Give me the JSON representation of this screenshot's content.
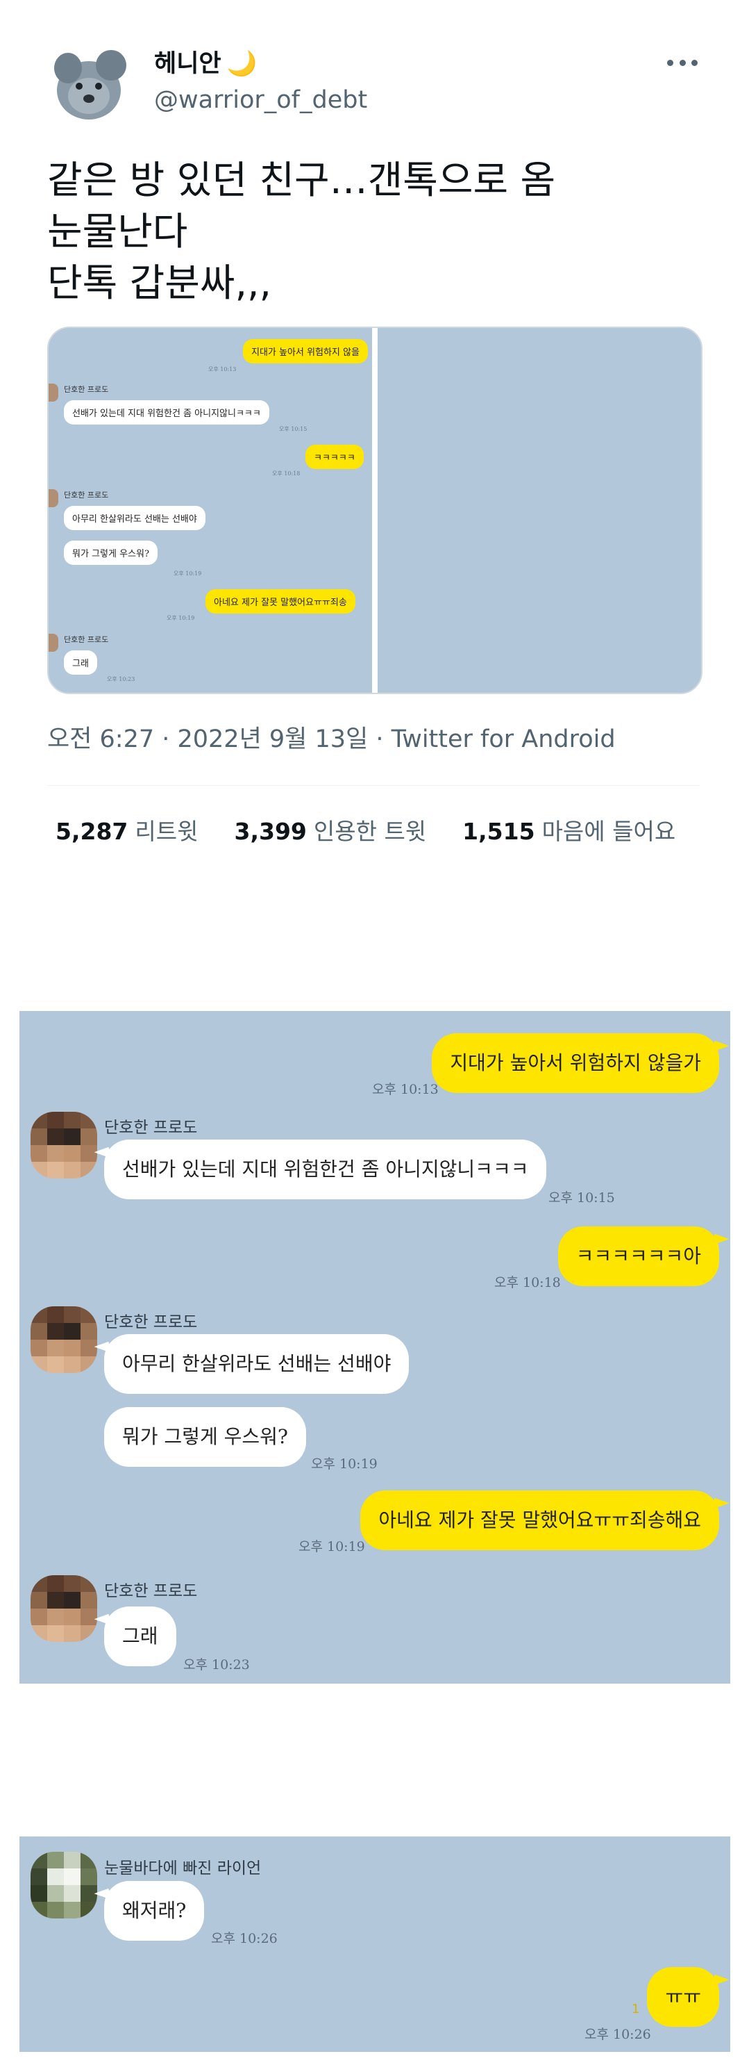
{
  "tweet": {
    "name": "헤니안",
    "moon_emoji": "🌙",
    "handle": "@warrior_of_debt",
    "text_lines": [
      "같은 방 있던 친구…갠톡으로 옴",
      "눈물난다",
      "단톡 갑분싸,,,"
    ],
    "meta": "오전 6:27 · 2022년 9월 13일 · Twitter for Android",
    "stats": [
      {
        "count": "5,287",
        "label": "리트윗"
      },
      {
        "count": "3,399",
        "label": "인용한 트윗"
      },
      {
        "count": "1,515",
        "label": "마음에 들어요"
      }
    ]
  },
  "media_preview": {
    "messages": {
      "m1": "지대가 높아서 위험하지 않을",
      "m1_time": "오후 10:13",
      "n1": "단호한 프로도",
      "m2": "선배가 있는데 지대 위험한건 좀 아니지않니ㅋㅋㅋ",
      "m2_time": "오후 10:15",
      "m3": "ㅋㅋㅋㅋㅋ",
      "m3_time": "오후 10:18",
      "n2": "단호한 프로도",
      "m4": "아무리 한살위라도 선배는 선배야",
      "m5": "뭐가 그렇게 우스워?",
      "m5_time": "오후 10:19",
      "m6": "아네요 제가 잘못 말했어요ㅠㅠ죄송",
      "m6_time": "오후 10:19",
      "n3": "단호한 프로도",
      "m7": "그래",
      "m7_time": "오후 10:23"
    }
  },
  "chat1": {
    "msg1": "지대가 높아서 위험하지 않을가",
    "msg1_time": "오후 10:13",
    "nick1": "단호한 프로도",
    "msg2": "선배가 있는데 지대 위험한건 좀 아니지않니ㅋㅋㅋ",
    "msg2_time": "오후 10:15",
    "msg3": "ㅋㅋㅋㅋㅋㅋ아",
    "msg3_time": "오후 10:18",
    "nick2": "단호한 프로도",
    "msg4": "아무리 한살위라도 선배는 선배야",
    "msg5": "뭐가 그렇게 우스워?",
    "msg5_time": "오후 10:19",
    "msg6": "아네요 제가 잘못 말했어요ㅠㅠ죄송해요",
    "msg6_time": "오후 10:19",
    "nick3": "단호한 프로도",
    "msg7": "그래",
    "msg7_time": "오후 10:23"
  },
  "chat2": {
    "nick": "눈물바다에 빠진 라이언",
    "msg1": "왜저래?",
    "msg1_time": "오후 10:26",
    "msg2": "ㅠㅠ",
    "msg2_time": "오후 10:26",
    "unread": "1"
  },
  "colors": {
    "chat_bg": "#b2c7da",
    "my_bubble": "#fee500",
    "their_bubble": "#ffffff",
    "secondary_text": "#536471"
  }
}
